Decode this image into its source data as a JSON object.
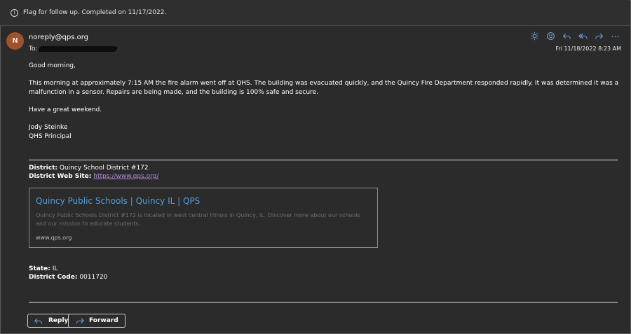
{
  "flag": {
    "icon": "info-circle-icon",
    "text": "Flag for follow up. Completed on 11/17/2022."
  },
  "message": {
    "avatar_initial": "N",
    "sender": "noreply@qps.org",
    "to_label": "To:",
    "datetime": "Fri 11/18/2022 8:23 AM",
    "actions": [
      "brightness-icon",
      "emoji-icon",
      "reply-icon",
      "reply-all-icon",
      "forward-icon",
      "more-icon"
    ]
  },
  "body": {
    "greeting": "Good morning,",
    "paragraph": "This morning at approximately 7:15 AM the fire alarm went off at QHS. The building was evacuated quickly, and the Quincy Fire Department responded rapidly. It was determined it was a malfunction in a sensor.  Repairs are being made, and the building is 100% safe and secure.",
    "closing": "Have a great weekend.",
    "signature_name": "Jody Steinke",
    "signature_title": "QHS Principal"
  },
  "district": {
    "district_label": "District:",
    "district_value": "Quincy School District #172",
    "website_label": "District Web Site:",
    "website_url": "https://www.qps.org/",
    "state_label": "State:",
    "state_value": "IL",
    "code_label": "District Code:",
    "code_value": "0011720"
  },
  "link_preview": {
    "title": "Quincy Public Schools | Quincy IL | QPS",
    "description": "Quincy Public Schools District #172 is located in west central Illinois in Quincy, IL. Discover more about our schools and our mission to educate students.",
    "domain": "www.qps.org"
  },
  "buttons": {
    "reply": "Reply",
    "forward": "Forward"
  },
  "colors": {
    "background": "#2b2b2b",
    "accent": "#6aa7e6",
    "avatar": "#a0522d",
    "link": "#b38cdb"
  }
}
